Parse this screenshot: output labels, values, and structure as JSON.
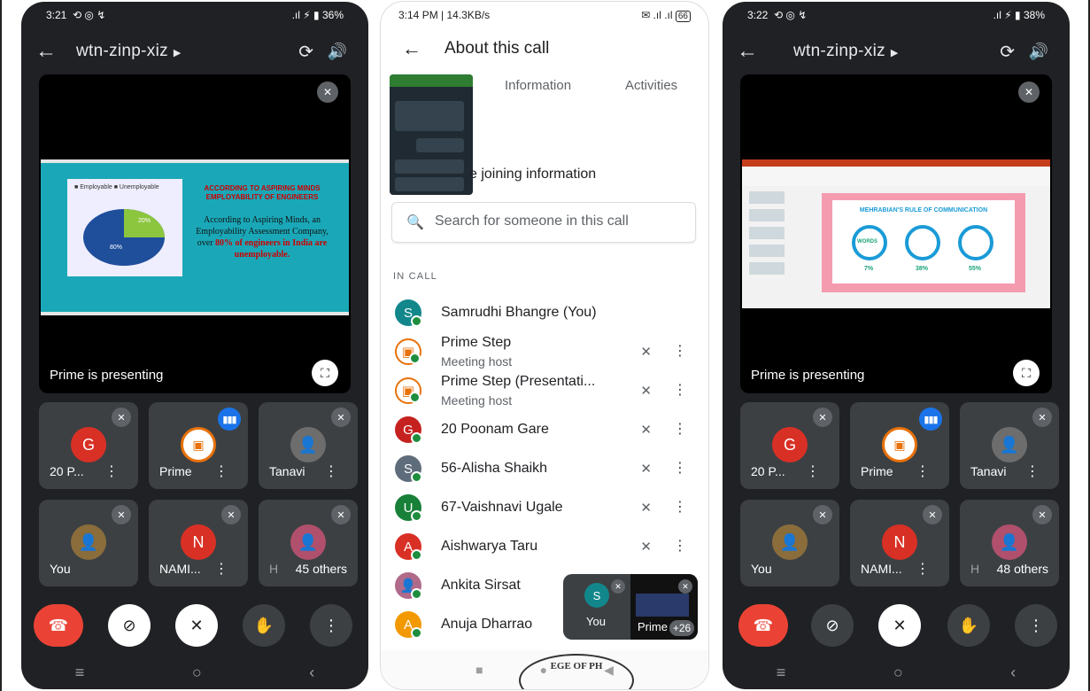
{
  "left_phone": {
    "status": {
      "time": "3:21",
      "battery": "36%"
    },
    "meeting_code": "wtn-zinp-xiz",
    "presenting_text": "Prime is presenting",
    "slide": {
      "legend": [
        "Employable",
        "Unemployable"
      ],
      "pie_labels": [
        "20%",
        "80%"
      ],
      "headline": "ACCORDING TO ASPIRING MINDS EMPLOYABILITY OF ENGINEERS",
      "body_a": "According to Aspiring Minds, an Employability Assessment Company, over ",
      "body_b": "80% of engineers in India are unemployable."
    },
    "tiles": [
      {
        "name": "20 P...",
        "initial": "G",
        "color": "#d93025"
      },
      {
        "name": "Prime",
        "initial": "",
        "color": "#ffffff"
      },
      {
        "name": "Tanavi",
        "initial": "",
        "color": "#6d6d6d"
      },
      {
        "name": "You",
        "initial": "",
        "color": "#8a6d3b"
      },
      {
        "name": "NAMI...",
        "initial": "N",
        "color": "#d93025"
      },
      {
        "name": "H",
        "initial": "",
        "color": "#b0506c",
        "others": "45 others"
      }
    ]
  },
  "center_phone": {
    "status": {
      "time": "3:14 PM | 14.3KB/s",
      "battery": "66"
    },
    "title": "About this call",
    "tabs": [
      "Information",
      "Activities"
    ],
    "joining_text": "e joining information",
    "search_placeholder": "Search for someone in this call",
    "section_label": "IN CALL",
    "participants": [
      {
        "name": "Samrudhi Bhangre (You)",
        "sub": "",
        "initial": "S",
        "color": "#12878b",
        "muted": false
      },
      {
        "name": "Prime Step",
        "sub": "Meeting host",
        "initial": "",
        "color": "#ffffff",
        "muted": true
      },
      {
        "name": "Prime Step (Presentati...",
        "sub": "Meeting host",
        "initial": "",
        "color": "#ffffff",
        "muted": true
      },
      {
        "name": "20 Poonam Gare",
        "sub": "",
        "initial": "G",
        "color": "#c5221f",
        "muted": true
      },
      {
        "name": "56-Alisha Shaikh",
        "sub": "",
        "initial": "S",
        "color": "#5f6c7b",
        "muted": true
      },
      {
        "name": "67-Vaishnavi Ugale",
        "sub": "",
        "initial": "U",
        "color": "#188038",
        "muted": true
      },
      {
        "name": "Aishwarya Taru",
        "sub": "",
        "initial": "A",
        "color": "#d93025",
        "muted": true
      },
      {
        "name": "Ankita Sirsat",
        "sub": "",
        "initial": "",
        "color": "#b06a8a",
        "muted": false
      },
      {
        "name": "Anuja Dharrao",
        "sub": "",
        "initial": "A",
        "color": "#f29900",
        "muted": false
      }
    ],
    "pip": {
      "self_initial": "S",
      "self_label": "You",
      "presenter_label": "Prime",
      "count": "+26"
    },
    "stamp_text": "EGE OF PH"
  },
  "right_phone": {
    "status": {
      "time": "3:22",
      "battery": "38%"
    },
    "meeting_code": "wtn-zinp-xiz",
    "presenting_text": "Prime is presenting",
    "slide": {
      "title": "MEHRABIAN'S RULE OF COMMUNICATION",
      "circle_label": "WORDS",
      "percents": [
        "7%",
        "38%",
        "55%"
      ]
    },
    "tiles": [
      {
        "name": "20 P...",
        "initial": "G",
        "color": "#d93025"
      },
      {
        "name": "Prime",
        "initial": "",
        "color": "#ffffff"
      },
      {
        "name": "Tanavi",
        "initial": "",
        "color": "#6d6d6d"
      },
      {
        "name": "You",
        "initial": "",
        "color": "#8a6d3b"
      },
      {
        "name": "NAMI...",
        "initial": "N",
        "color": "#d93025"
      },
      {
        "name": "H",
        "initial": "",
        "color": "#b0506c",
        "others": "48 others"
      }
    ]
  },
  "icons": {
    "back": "arrow-left-icon",
    "camera_switch": "camera-switch-icon",
    "speaker": "speaker-icon",
    "mic_off": "mic-off-icon",
    "more": "more-vert-icon",
    "end_call": "end-call-icon",
    "camera_off": "camera-off-icon",
    "raise_hand": "raise-hand-icon",
    "fullscreen": "fullscreen-icon",
    "search": "search-icon"
  },
  "colors": {
    "dark_bg": "#202124",
    "tile_bg": "#3c4043",
    "end_call": "#ea4335",
    "accent_blue": "#1a73e8"
  }
}
